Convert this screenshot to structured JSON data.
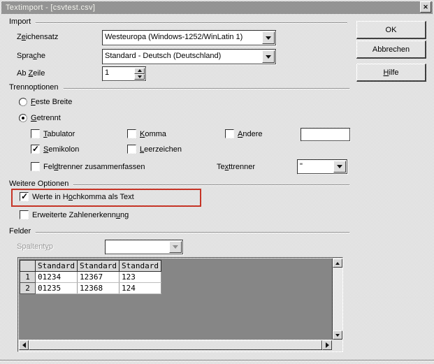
{
  "window": {
    "title": "Textimport - [csvtest.csv]",
    "close_glyph": "✕"
  },
  "action_buttons": {
    "ok": "OK",
    "cancel": "Abbrechen",
    "help": {
      "t": "Hilfe",
      "m": 0
    }
  },
  "import": {
    "title": "Import",
    "charset_label": {
      "t": "Zeichensatz",
      "m": 1
    },
    "charset_value": "Westeuropa (Windows-1252/WinLatin 1)",
    "language_label": {
      "t": "Sprache",
      "m": 4
    },
    "language_value": "Standard - Deutsch (Deutschland)",
    "from_row_label": {
      "t": "Ab Zeile",
      "m": 3
    },
    "from_row_value": "1"
  },
  "separator_options": {
    "title": "Trennoptionen",
    "fixed_width": {
      "label": {
        "t": "Feste Breite",
        "m": 0
      },
      "selected": false
    },
    "delimited": {
      "label": {
        "t": "Getrennt",
        "m": 0
      },
      "selected": true
    },
    "tab": {
      "label": {
        "t": "Tabulator",
        "m": 0
      },
      "checked": false
    },
    "comma": {
      "label": {
        "t": "Komma",
        "m": 0
      },
      "checked": false
    },
    "other": {
      "label": {
        "t": "Andere",
        "m": 0
      },
      "checked": false,
      "value": ""
    },
    "semicolon": {
      "label": {
        "t": "Semikolon",
        "m": 0
      },
      "checked": true
    },
    "space": {
      "label": {
        "t": "Leerzeichen",
        "m": 0
      },
      "checked": false
    },
    "merge_delimiters": {
      "label": {
        "t": "Feldtrenner zusammenfassen",
        "m": 3
      },
      "checked": false
    },
    "text_delimiter_label": {
      "t": "Texttrenner",
      "m": 2
    },
    "text_delimiter_value": "\""
  },
  "other_options": {
    "title": "Weitere Optionen",
    "quoted_field_as_text": {
      "label": {
        "t": "Werte in Hochkomma als Text",
        "m": 10
      },
      "checked": true
    },
    "detect_special_numbers": {
      "label": {
        "t": "Erweiterte Zahlenerkennung",
        "m": 23
      },
      "checked": false
    }
  },
  "fields": {
    "title": "Felder",
    "column_type_label": {
      "t": "Spaltentyp",
      "m": 8
    },
    "column_type_value": ""
  },
  "preview": {
    "headers": [
      "Standard",
      "Standard",
      "Standard"
    ],
    "rows": [
      {
        "num": "1",
        "cells": [
          "01234",
          "12367",
          "123"
        ]
      },
      {
        "num": "2",
        "cells": [
          "01235",
          "12368",
          "124"
        ]
      }
    ]
  },
  "colors": {
    "annotation_red": "#c63426",
    "titlebar_gray": "#939393",
    "grid_area_gray": "#868686",
    "dialog_face": "#d8d8d8"
  }
}
